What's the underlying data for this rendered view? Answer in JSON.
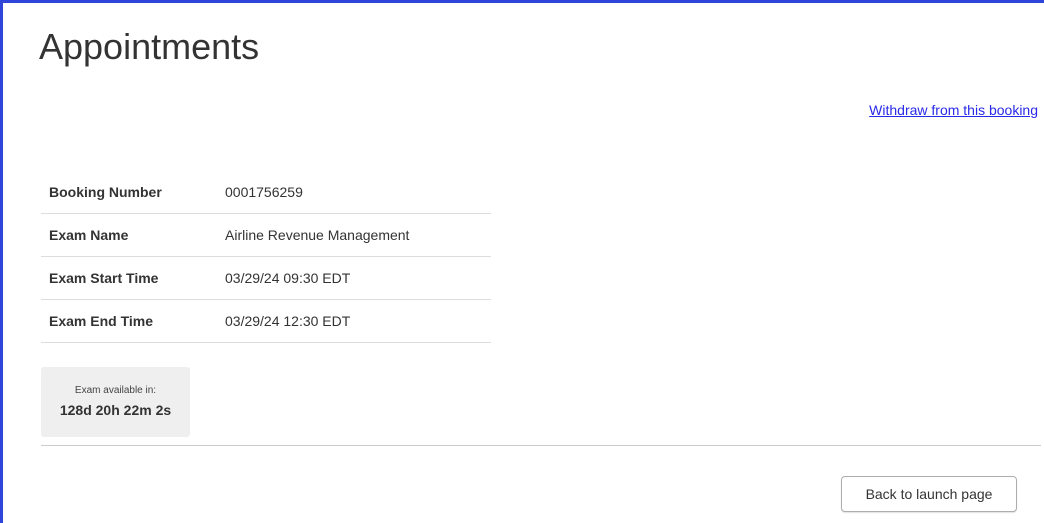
{
  "page": {
    "title": "Appointments"
  },
  "actions": {
    "withdraw_link": "Withdraw from this booking",
    "back_button": "Back to launch page"
  },
  "booking": {
    "rows": [
      {
        "label": "Booking Number",
        "value": "0001756259"
      },
      {
        "label": "Exam Name",
        "value": "Airline Revenue Management"
      },
      {
        "label": "Exam Start Time",
        "value": "03/29/24 09:30 EDT"
      },
      {
        "label": "Exam End Time",
        "value": "03/29/24 12:30 EDT"
      }
    ]
  },
  "countdown": {
    "label": "Exam available in:",
    "value": "128d 20h 22m 2s"
  },
  "colors": {
    "accent_border": "#2f44d8",
    "link": "#2929e8"
  }
}
